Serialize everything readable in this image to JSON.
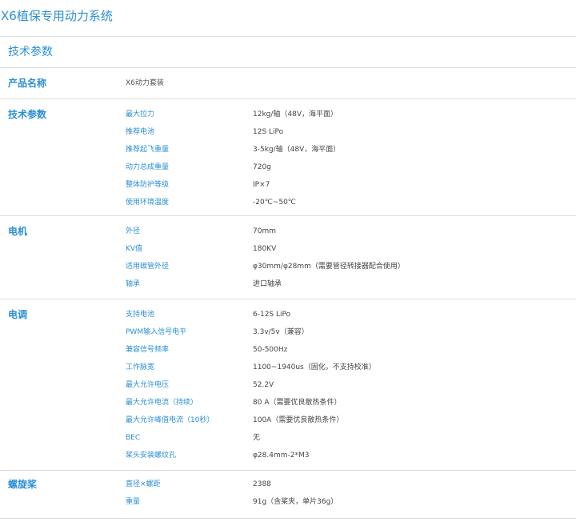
{
  "page_title": "X6植保专用动力系统",
  "spec_header": "技术参数",
  "sections": [
    {
      "title": "产品名称",
      "rows": [
        {
          "label": "X6动力套装",
          "value": ""
        }
      ]
    },
    {
      "title": "技术参数",
      "rows": [
        {
          "label": "最大拉力",
          "value": "12kg/轴（48V，海平面）"
        },
        {
          "label": "推荐电池",
          "value": "12S LiPo"
        },
        {
          "label": "推荐起飞重量",
          "value": "3-5kg/轴（48V，海平面）"
        },
        {
          "label": "动力总成重量",
          "value": "720g"
        },
        {
          "label": "整体防护等级",
          "value": "IP×7"
        },
        {
          "label": "使用环境温度",
          "value": "-20℃~50℃"
        }
      ]
    },
    {
      "title": "电机",
      "rows": [
        {
          "label": "外径",
          "value": "70mm"
        },
        {
          "label": "KV值",
          "value": "180KV"
        },
        {
          "label": "适用碳管外径",
          "value": "φ30mm/φ28mm（需要管径转接器配合使用）"
        },
        {
          "label": "轴承",
          "value": "进口轴承"
        }
      ]
    },
    {
      "title": "电调",
      "rows": [
        {
          "label": "支持电池",
          "value": "6-12S LiPo"
        },
        {
          "label": "PWM输入信号电平",
          "value": "3.3v/5v（兼容）"
        },
        {
          "label": "兼容信号频率",
          "value": "50-500Hz"
        },
        {
          "label": "工作脉宽",
          "value": "1100~1940us（固化，不支持校准）"
        },
        {
          "label": "最大允许电压",
          "value": "52.2V"
        },
        {
          "label": "最大允许电流（持续）",
          "value": "80 A（需要优良散热条件）"
        },
        {
          "label": "最大允许峰值电流（10秒）",
          "value": "100A（需要优良散热条件）"
        },
        {
          "label": "BEC",
          "value": "无"
        },
        {
          "label": "桨头安装螺纹孔",
          "value": "φ28.4mm-2*M3"
        }
      ]
    },
    {
      "title": "螺旋桨",
      "rows": [
        {
          "label": "直径×螺距",
          "value": "2388"
        },
        {
          "label": "重量",
          "value": "91g（含桨夹，单片36g）"
        }
      ]
    }
  ]
}
